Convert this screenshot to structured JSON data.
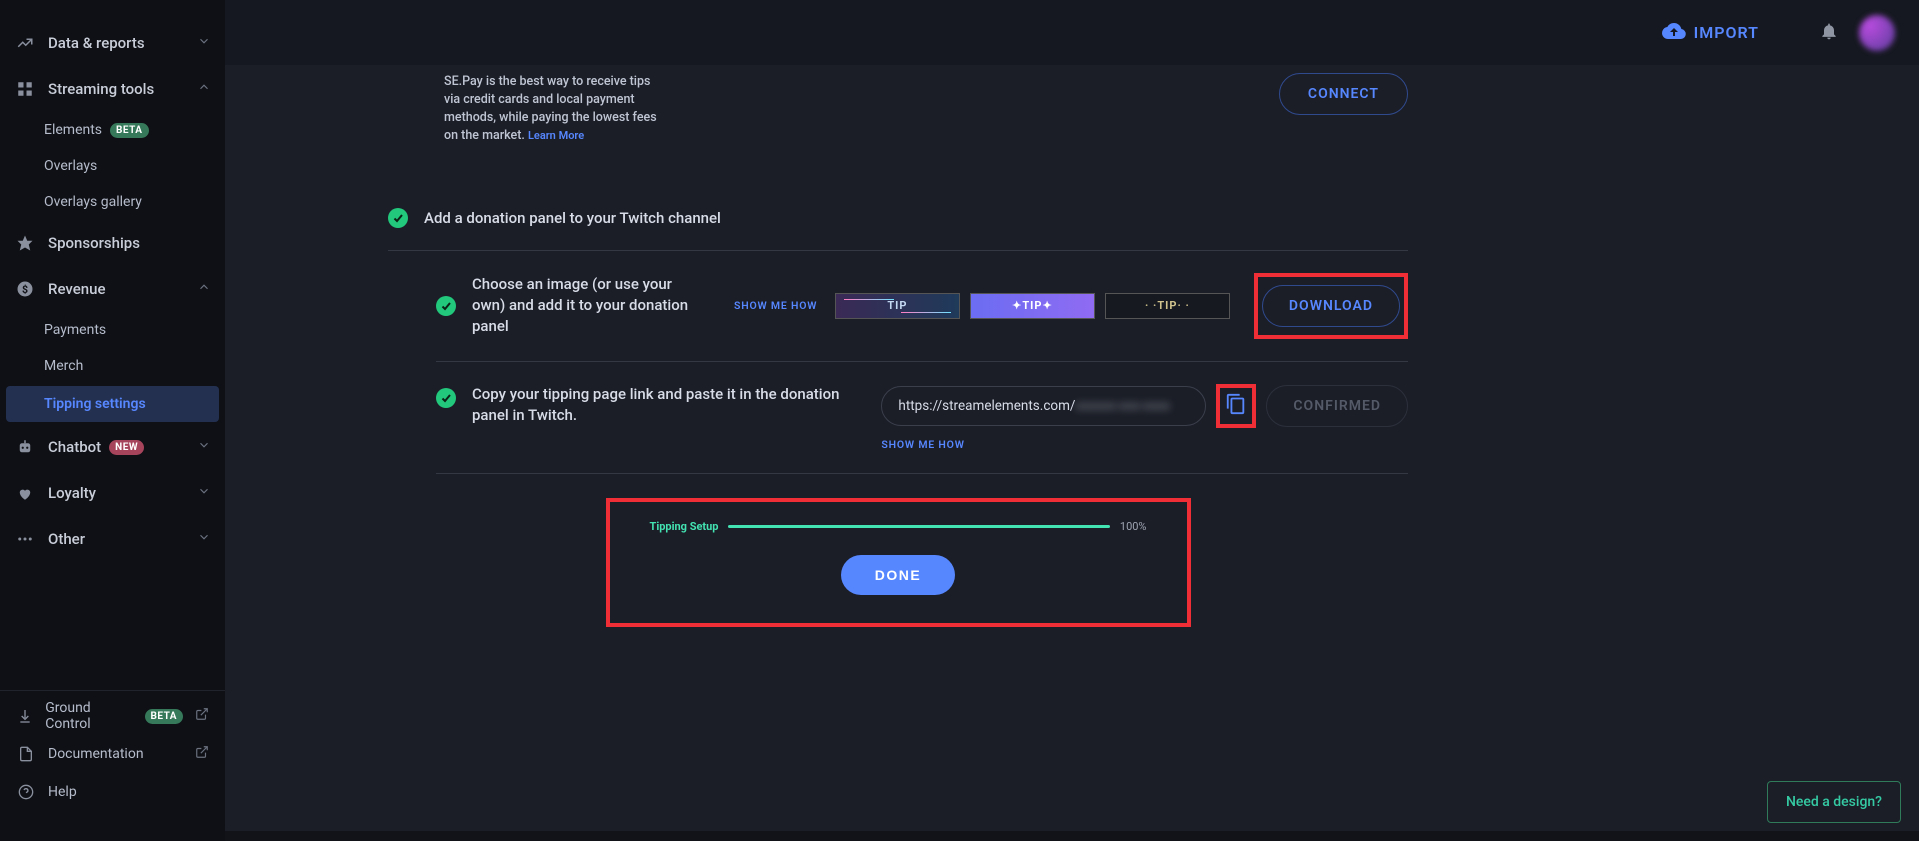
{
  "header": {
    "import_label": "IMPORT"
  },
  "sidebar": {
    "items": {
      "data_reports": "Data & reports",
      "streaming_tools": "Streaming tools",
      "elements": "Elements",
      "beta": "BETA",
      "overlays": "Overlays",
      "overlays_gallery": "Overlays gallery",
      "sponsorships": "Sponsorships",
      "revenue": "Revenue",
      "payments": "Payments",
      "merch": "Merch",
      "tipping_settings": "Tipping settings",
      "chatbot": "Chatbot",
      "new": "NEW",
      "loyalty": "Loyalty",
      "other": "Other"
    },
    "bottom": {
      "ground_control": "Ground Control",
      "documentation": "Documentation",
      "help": "Help"
    }
  },
  "main": {
    "sepay_text_1": "SE.Pay is the best way to receive tips via credit cards and local payment methods, while paying the lowest fees on the market.",
    "learn_more": "Learn More",
    "connect": "CONNECT",
    "add_panel": "Add a donation panel to your Twitch channel",
    "choose_image": "Choose an image (or use your own) and add it to your donation panel",
    "show_me_how": "SHOW ME HOW",
    "tip_label": "TIP",
    "download": "DOWNLOAD",
    "copy_link_desc": "Copy your tipping page link and paste it in the donation panel in Twitch.",
    "url_value": "https://streamelements.com/",
    "url_hidden": "xxxxxx-xxx-xxxx",
    "confirmed": "CONFIRMED",
    "tipping_setup": "Tipping Setup",
    "progress_pct": "100%",
    "done": "DONE"
  },
  "need_design": "Need a design?"
}
